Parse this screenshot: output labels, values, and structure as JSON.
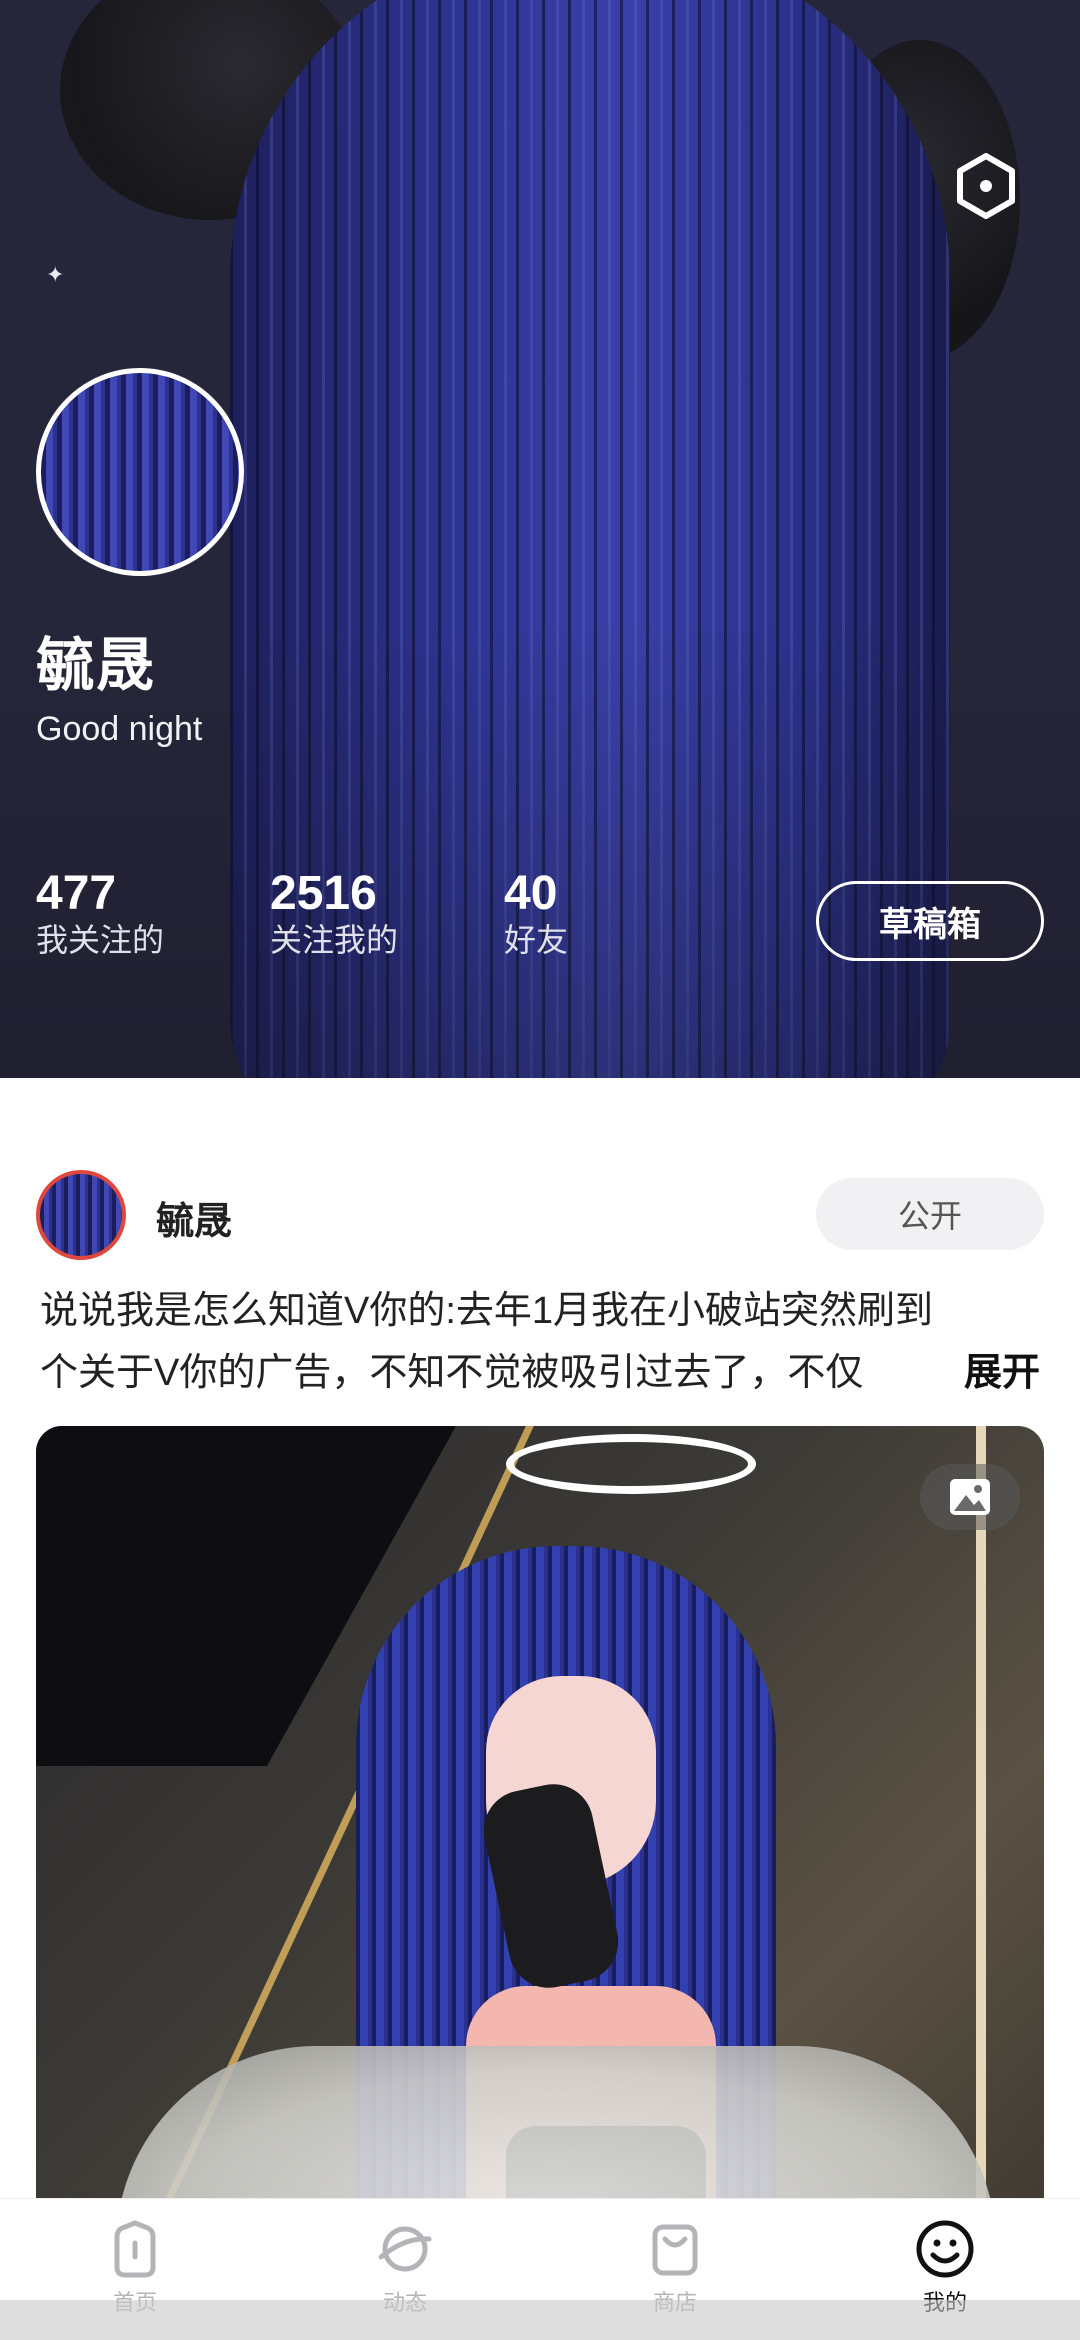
{
  "profile": {
    "name": "毓晟",
    "bio": "Good night",
    "stats": [
      {
        "value": "477",
        "label": "我关注的"
      },
      {
        "value": "2516",
        "label": "关注我的"
      },
      {
        "value": "40",
        "label": "好友"
      }
    ],
    "drafts_label": "草稿箱"
  },
  "post": {
    "author": "毓晟",
    "visibility": "公开",
    "text_line1": "说说我是怎么知道V你的:去年1月我在小破站突然刷到",
    "text_line2": "个关于V你的广告，不知不觉被吸引过去了，不仅",
    "expand_label": "展开"
  },
  "nav": {
    "items": [
      {
        "label": "首页",
        "icon": "home-icon",
        "active": false
      },
      {
        "label": "动态",
        "icon": "planet-icon",
        "active": false
      },
      {
        "label": "商店",
        "icon": "shopping-bag-icon",
        "active": false
      },
      {
        "label": "我的",
        "icon": "smiley-icon",
        "active": true
      }
    ]
  },
  "colors": {
    "accent_ring": "#e0483e",
    "active_nav": "#111111",
    "inactive_nav": "#b4b4b8"
  }
}
